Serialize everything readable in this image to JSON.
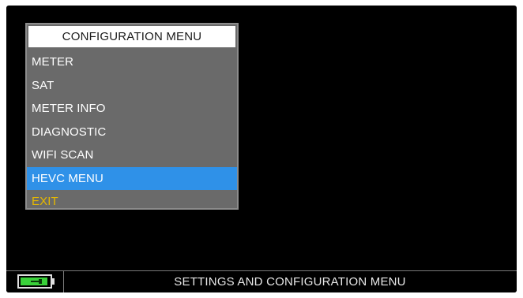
{
  "menu": {
    "title": "CONFIGURATION MENU",
    "items": [
      {
        "label": "METER",
        "selected": false
      },
      {
        "label": "SAT",
        "selected": false
      },
      {
        "label": "METER INFO",
        "selected": false
      },
      {
        "label": "DIAGNOSTIC",
        "selected": false
      },
      {
        "label": "WIFI SCAN",
        "selected": false
      },
      {
        "label": "HEVC MENU",
        "selected": true
      },
      {
        "label": "EXIT",
        "selected": false
      }
    ]
  },
  "status_bar": {
    "icon": "battery-charging-icon",
    "text": "SETTINGS AND CONFIGURATION MENU"
  },
  "colors": {
    "screen_background": "#000000",
    "menu_background": "#6a6a6a",
    "selection_highlight": "#2f91e8",
    "exit_text": "#e6b800",
    "battery_fill": "#3ad13a"
  }
}
